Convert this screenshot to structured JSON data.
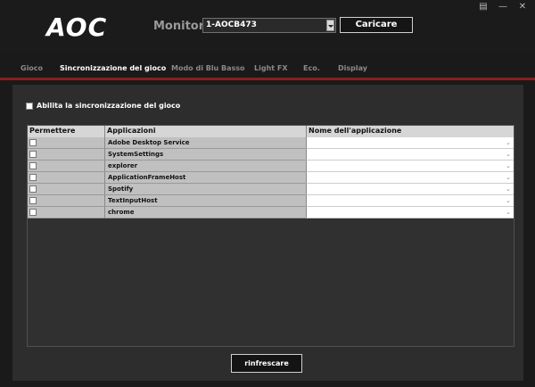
{
  "header": {
    "logo_text": "AOC",
    "monitor_label": "Monitore",
    "monitor_value": "1-AOCB473",
    "load_button": "Caricare"
  },
  "window_controls": {
    "chat_icon": "chat-icon",
    "minimize_icon": "minimize-icon",
    "close_icon": "close-icon"
  },
  "tabs": [
    {
      "label": "Gioco",
      "active": false
    },
    {
      "label": "Sincronizzazione del gioco",
      "active": true
    },
    {
      "label": "Modo di Blu Basso",
      "active": false
    },
    {
      "label": "Light FX",
      "active": false
    },
    {
      "label": "Eco.",
      "active": false
    },
    {
      "label": "Display",
      "active": false
    }
  ],
  "sync": {
    "enable_label": "Abilita la sincronizzazione del gioco",
    "enable_checked": false
  },
  "table": {
    "headers": [
      "Permettere",
      "Applicazioni",
      "Nome dell'applicazione"
    ],
    "rows": [
      {
        "app": "Adobe Desktop Service",
        "name": ""
      },
      {
        "app": "SystemSettings",
        "name": ""
      },
      {
        "app": "explorer",
        "name": ""
      },
      {
        "app": "ApplicationFrameHost",
        "name": ""
      },
      {
        "app": "Spotify",
        "name": ""
      },
      {
        "app": "TextInputHost",
        "name": ""
      },
      {
        "app": "chrome",
        "name": ""
      }
    ]
  },
  "refresh_button": "rinfrescare",
  "colors": {
    "accent_red": "#8a1f1f",
    "background": "#1a1a1a",
    "panel": "#2d2d2d"
  }
}
